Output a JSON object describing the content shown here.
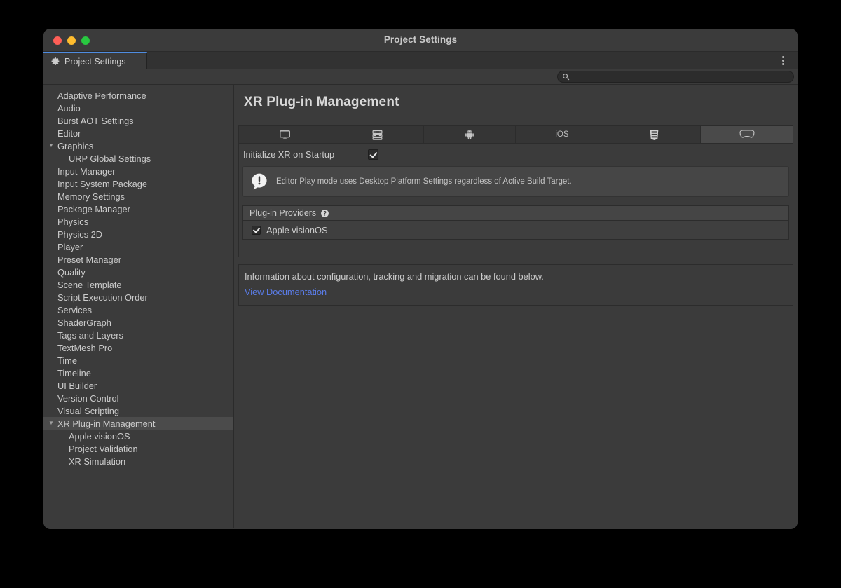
{
  "window": {
    "title": "Project Settings",
    "controls": [
      "close",
      "minimize",
      "maximize"
    ]
  },
  "tabstrip": {
    "active_tab_label": "Project Settings",
    "gear_icon": "gear-icon",
    "overflow_menu_icon": "kebab-menu-icon"
  },
  "search": {
    "value": "",
    "placeholder": "",
    "icon": "search-icon"
  },
  "sidebar": {
    "items": [
      {
        "label": "Adaptive Performance",
        "foldout": "",
        "indent": false,
        "selected": false
      },
      {
        "label": "Audio",
        "foldout": "",
        "indent": false,
        "selected": false
      },
      {
        "label": "Burst AOT Settings",
        "foldout": "",
        "indent": false,
        "selected": false
      },
      {
        "label": "Editor",
        "foldout": "",
        "indent": false,
        "selected": false
      },
      {
        "label": "Graphics",
        "foldout": "▼",
        "indent": false,
        "selected": false
      },
      {
        "label": "URP Global Settings",
        "foldout": "",
        "indent": true,
        "selected": false
      },
      {
        "label": "Input Manager",
        "foldout": "",
        "indent": false,
        "selected": false
      },
      {
        "label": "Input System Package",
        "foldout": "",
        "indent": false,
        "selected": false
      },
      {
        "label": "Memory Settings",
        "foldout": "",
        "indent": false,
        "selected": false
      },
      {
        "label": "Package Manager",
        "foldout": "",
        "indent": false,
        "selected": false
      },
      {
        "label": "Physics",
        "foldout": "",
        "indent": false,
        "selected": false
      },
      {
        "label": "Physics 2D",
        "foldout": "",
        "indent": false,
        "selected": false
      },
      {
        "label": "Player",
        "foldout": "",
        "indent": false,
        "selected": false
      },
      {
        "label": "Preset Manager",
        "foldout": "",
        "indent": false,
        "selected": false
      },
      {
        "label": "Quality",
        "foldout": "",
        "indent": false,
        "selected": false
      },
      {
        "label": "Scene Template",
        "foldout": "",
        "indent": false,
        "selected": false
      },
      {
        "label": "Script Execution Order",
        "foldout": "",
        "indent": false,
        "selected": false
      },
      {
        "label": "Services",
        "foldout": "",
        "indent": false,
        "selected": false
      },
      {
        "label": "ShaderGraph",
        "foldout": "",
        "indent": false,
        "selected": false
      },
      {
        "label": "Tags and Layers",
        "foldout": "",
        "indent": false,
        "selected": false
      },
      {
        "label": "TextMesh Pro",
        "foldout": "",
        "indent": false,
        "selected": false
      },
      {
        "label": "Time",
        "foldout": "",
        "indent": false,
        "selected": false
      },
      {
        "label": "Timeline",
        "foldout": "",
        "indent": false,
        "selected": false
      },
      {
        "label": "UI Builder",
        "foldout": "",
        "indent": false,
        "selected": false
      },
      {
        "label": "Version Control",
        "foldout": "",
        "indent": false,
        "selected": false
      },
      {
        "label": "Visual Scripting",
        "foldout": "",
        "indent": false,
        "selected": false
      },
      {
        "label": "XR Plug-in Management",
        "foldout": "▼",
        "indent": false,
        "selected": true
      },
      {
        "label": "Apple visionOS",
        "foldout": "",
        "indent": true,
        "selected": false
      },
      {
        "label": "Project Validation",
        "foldout": "",
        "indent": true,
        "selected": false
      },
      {
        "label": "XR Simulation",
        "foldout": "",
        "indent": true,
        "selected": false
      }
    ]
  },
  "main": {
    "page_title": "XR Plug-in Management",
    "platform_tabs": [
      {
        "label": "",
        "icon": "desktop-monitor-icon",
        "active": false
      },
      {
        "label": "",
        "icon": "dedicated-server-icon",
        "active": false
      },
      {
        "label": "",
        "icon": "android-robot-icon",
        "active": false
      },
      {
        "label": "iOS",
        "icon": "",
        "active": false
      },
      {
        "label": "",
        "icon": "webgl-html5-icon",
        "active": false
      },
      {
        "label": "",
        "icon": "visionos-headset-icon",
        "active": true
      }
    ],
    "initialize_xr": {
      "label": "Initialize XR on Startup",
      "checked": true
    },
    "info_box": {
      "icon": "info-exclamation-icon",
      "text": "Editor Play mode uses Desktop Platform Settings regardless of Active Build Target."
    },
    "providers": {
      "header": "Plug-in Providers",
      "help_icon": "help-question-icon",
      "rows": [
        {
          "name": "Apple visionOS",
          "checked": true
        }
      ]
    },
    "documentation": {
      "text": "Information about configuration, tracking and migration can be found below.",
      "link_label": "View Documentation"
    }
  },
  "colors": {
    "window_bg": "#3b3b3b",
    "panel_bg": "#353535",
    "selected_row": "#4b4b4b",
    "accent_tab": "#4f8ce0",
    "link": "#5a7ce8",
    "info_box_bg": "#464646"
  }
}
